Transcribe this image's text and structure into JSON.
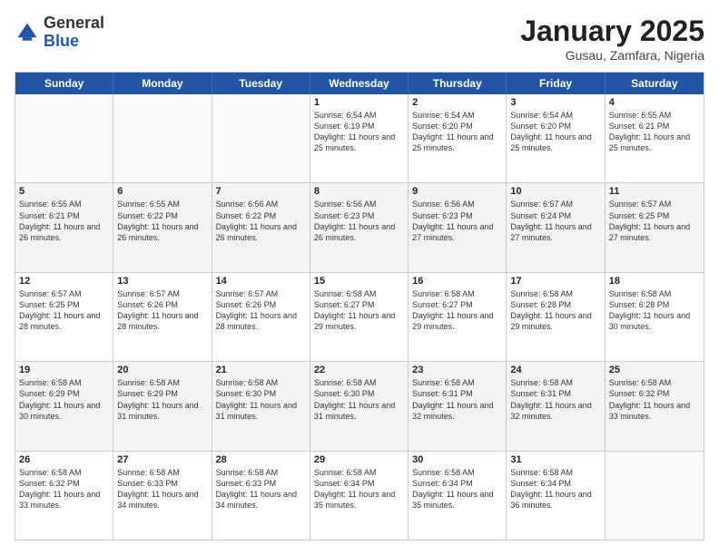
{
  "header": {
    "logo_general": "General",
    "logo_blue": "Blue",
    "title": "January 2025",
    "subtitle": "Gusau, Zamfara, Nigeria"
  },
  "days_of_week": [
    "Sunday",
    "Monday",
    "Tuesday",
    "Wednesday",
    "Thursday",
    "Friday",
    "Saturday"
  ],
  "weeks": [
    [
      {
        "day": "",
        "text": ""
      },
      {
        "day": "",
        "text": ""
      },
      {
        "day": "",
        "text": ""
      },
      {
        "day": "1",
        "text": "Sunrise: 6:54 AM\nSunset: 6:19 PM\nDaylight: 11 hours and 25 minutes."
      },
      {
        "day": "2",
        "text": "Sunrise: 6:54 AM\nSunset: 6:20 PM\nDaylight: 11 hours and 25 minutes."
      },
      {
        "day": "3",
        "text": "Sunrise: 6:54 AM\nSunset: 6:20 PM\nDaylight: 11 hours and 25 minutes."
      },
      {
        "day": "4",
        "text": "Sunrise: 6:55 AM\nSunset: 6:21 PM\nDaylight: 11 hours and 25 minutes."
      }
    ],
    [
      {
        "day": "5",
        "text": "Sunrise: 6:55 AM\nSunset: 6:21 PM\nDaylight: 11 hours and 26 minutes."
      },
      {
        "day": "6",
        "text": "Sunrise: 6:55 AM\nSunset: 6:22 PM\nDaylight: 11 hours and 26 minutes."
      },
      {
        "day": "7",
        "text": "Sunrise: 6:56 AM\nSunset: 6:22 PM\nDaylight: 11 hours and 26 minutes."
      },
      {
        "day": "8",
        "text": "Sunrise: 6:56 AM\nSunset: 6:23 PM\nDaylight: 11 hours and 26 minutes."
      },
      {
        "day": "9",
        "text": "Sunrise: 6:56 AM\nSunset: 6:23 PM\nDaylight: 11 hours and 27 minutes."
      },
      {
        "day": "10",
        "text": "Sunrise: 6:57 AM\nSunset: 6:24 PM\nDaylight: 11 hours and 27 minutes."
      },
      {
        "day": "11",
        "text": "Sunrise: 6:57 AM\nSunset: 6:25 PM\nDaylight: 11 hours and 27 minutes."
      }
    ],
    [
      {
        "day": "12",
        "text": "Sunrise: 6:57 AM\nSunset: 6:25 PM\nDaylight: 11 hours and 28 minutes."
      },
      {
        "day": "13",
        "text": "Sunrise: 6:57 AM\nSunset: 6:26 PM\nDaylight: 11 hours and 28 minutes."
      },
      {
        "day": "14",
        "text": "Sunrise: 6:57 AM\nSunset: 6:26 PM\nDaylight: 11 hours and 28 minutes."
      },
      {
        "day": "15",
        "text": "Sunrise: 6:58 AM\nSunset: 6:27 PM\nDaylight: 11 hours and 29 minutes."
      },
      {
        "day": "16",
        "text": "Sunrise: 6:58 AM\nSunset: 6:27 PM\nDaylight: 11 hours and 29 minutes."
      },
      {
        "day": "17",
        "text": "Sunrise: 6:58 AM\nSunset: 6:28 PM\nDaylight: 11 hours and 29 minutes."
      },
      {
        "day": "18",
        "text": "Sunrise: 6:58 AM\nSunset: 6:28 PM\nDaylight: 11 hours and 30 minutes."
      }
    ],
    [
      {
        "day": "19",
        "text": "Sunrise: 6:58 AM\nSunset: 6:29 PM\nDaylight: 11 hours and 30 minutes."
      },
      {
        "day": "20",
        "text": "Sunrise: 6:58 AM\nSunset: 6:29 PM\nDaylight: 11 hours and 31 minutes."
      },
      {
        "day": "21",
        "text": "Sunrise: 6:58 AM\nSunset: 6:30 PM\nDaylight: 11 hours and 31 minutes."
      },
      {
        "day": "22",
        "text": "Sunrise: 6:58 AM\nSunset: 6:30 PM\nDaylight: 11 hours and 31 minutes."
      },
      {
        "day": "23",
        "text": "Sunrise: 6:58 AM\nSunset: 6:31 PM\nDaylight: 11 hours and 32 minutes."
      },
      {
        "day": "24",
        "text": "Sunrise: 6:58 AM\nSunset: 6:31 PM\nDaylight: 11 hours and 32 minutes."
      },
      {
        "day": "25",
        "text": "Sunrise: 6:58 AM\nSunset: 6:32 PM\nDaylight: 11 hours and 33 minutes."
      }
    ],
    [
      {
        "day": "26",
        "text": "Sunrise: 6:58 AM\nSunset: 6:32 PM\nDaylight: 11 hours and 33 minutes."
      },
      {
        "day": "27",
        "text": "Sunrise: 6:58 AM\nSunset: 6:33 PM\nDaylight: 11 hours and 34 minutes."
      },
      {
        "day": "28",
        "text": "Sunrise: 6:58 AM\nSunset: 6:33 PM\nDaylight: 11 hours and 34 minutes."
      },
      {
        "day": "29",
        "text": "Sunrise: 6:58 AM\nSunset: 6:34 PM\nDaylight: 11 hours and 35 minutes."
      },
      {
        "day": "30",
        "text": "Sunrise: 6:58 AM\nSunset: 6:34 PM\nDaylight: 11 hours and 35 minutes."
      },
      {
        "day": "31",
        "text": "Sunrise: 6:58 AM\nSunset: 6:34 PM\nDaylight: 11 hours and 36 minutes."
      },
      {
        "day": "",
        "text": ""
      }
    ]
  ]
}
